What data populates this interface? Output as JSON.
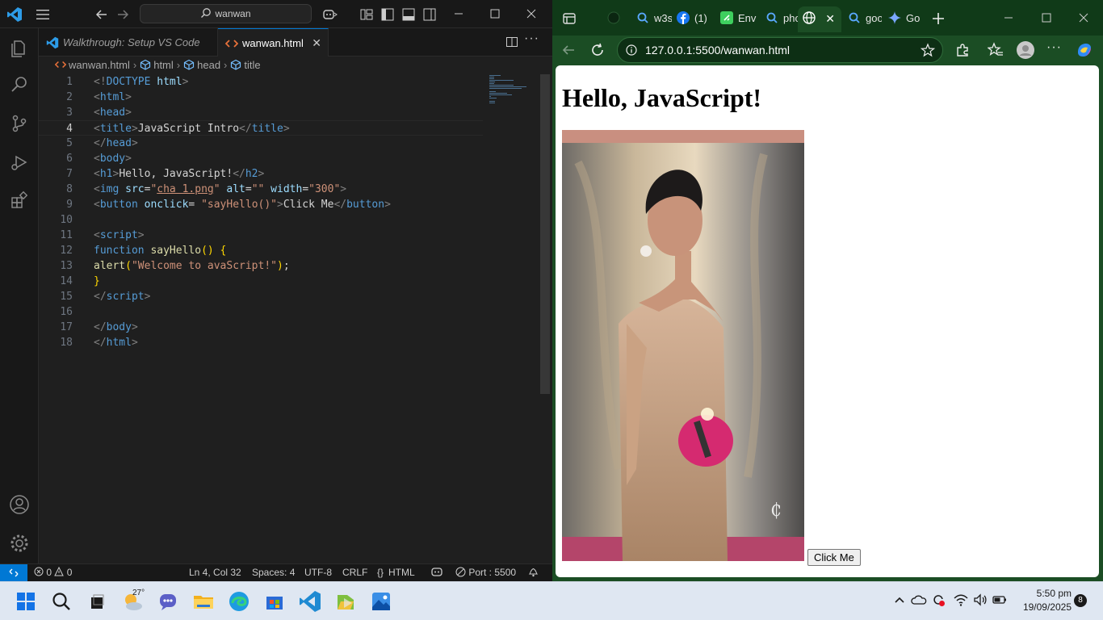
{
  "vscode": {
    "search": {
      "text": "wanwan"
    },
    "tabs": [
      {
        "label": "Walkthrough: Setup VS Code",
        "active": false
      },
      {
        "label": "wanwan.html",
        "active": true
      }
    ],
    "breadcrumb": [
      "wanwan.html",
      "html",
      "head",
      "title"
    ],
    "line_numbers": [
      "1",
      "2",
      "3",
      "4",
      "5",
      "6",
      "7",
      "8",
      "9",
      "10",
      "11",
      "12",
      "13",
      "14",
      "15",
      "16",
      "17",
      "18"
    ],
    "code": {
      "l1": {
        "a": "<!",
        "b": "DOCTYPE",
        "c": " html",
        "d": ">"
      },
      "l2": {
        "a": "<",
        "b": "html",
        "c": ">"
      },
      "l3": {
        "a": "<",
        "b": "head",
        "c": ">"
      },
      "l4": {
        "a": "<",
        "b": "title",
        "c": ">",
        "d": "JavaScript Intro",
        "e": "</",
        "f": "title",
        "g": ">"
      },
      "l5": {
        "a": "</",
        "b": "head",
        "c": ">"
      },
      "l6": {
        "a": "<",
        "b": "body",
        "c": ">"
      },
      "l7": {
        "a": "<",
        "b": "h1",
        "c": ">",
        "d": "Hello, JavaScript!",
        "e": "</",
        "f": "h2",
        "g": ">"
      },
      "l8": {
        "a": "<",
        "b": "img",
        "c": " src",
        "d": "=",
        "e": "\"",
        "f": "cha 1.png",
        "g": "\"",
        "h": " alt",
        "i": "=",
        "j": "\"\"",
        "k": " width",
        "l": "=",
        "m": "\"300\"",
        "n": ">"
      },
      "l9": {
        "a": "<",
        "b": "button",
        "c": " onclick",
        "d": "= ",
        "e": "\"sayHello()\"",
        "f": ">",
        "g": "Click Me",
        "h": "</",
        "i": "button",
        "j": ">"
      },
      "l11": {
        "a": "<",
        "b": "script",
        "c": ">"
      },
      "l12": {
        "a": "function",
        "b": " sayHello",
        "c": "()",
        "d": " {"
      },
      "l13": {
        "a": "alert",
        "b": "(",
        "c": "\"Welcome to avaScript!\"",
        "d": ")",
        "e": ";"
      },
      "l14": {
        "a": "}"
      },
      "l15": {
        "a": "</",
        "b": "script",
        "c": ">"
      },
      "l17": {
        "a": "</",
        "b": "body",
        "c": ">"
      },
      "l18": {
        "a": "</",
        "b": "html",
        "c": ">"
      }
    },
    "status": {
      "errors": "0",
      "warnings": "0",
      "position": "Ln 4, Col 32",
      "spaces": "Spaces: 4",
      "encoding": "UTF-8",
      "eol": "CRLF",
      "language": "HTML",
      "port": "Port : 5500"
    }
  },
  "edge": {
    "tabs": [
      {
        "label": "",
        "icon": "dark-circle-icon"
      },
      {
        "label": "w3s",
        "icon": "search-icon"
      },
      {
        "label": "(1)",
        "icon": "facebook-icon"
      },
      {
        "label": "Env",
        "icon": "green-app-icon"
      },
      {
        "label": "pho",
        "icon": "search-icon"
      },
      {
        "label": "",
        "icon": "globe-icon",
        "active": true
      },
      {
        "label": "goo",
        "icon": "search-icon"
      },
      {
        "label": "Go",
        "icon": "gemini-icon"
      }
    ],
    "url": "127.0.0.1:5500/wanwan.html",
    "page": {
      "heading": "Hello, JavaScript!",
      "button_label": "Click Me"
    }
  },
  "taskbar": {
    "weather_temp": "27°",
    "time": "5:50 pm",
    "date": "19/09/2025",
    "notifications": "8"
  },
  "colors": {
    "vscode_bg": "#1f1f1f",
    "vscode_accent": "#0078d4",
    "edge_frame": "#1b4d24",
    "taskbar": "#dfe7f2"
  }
}
